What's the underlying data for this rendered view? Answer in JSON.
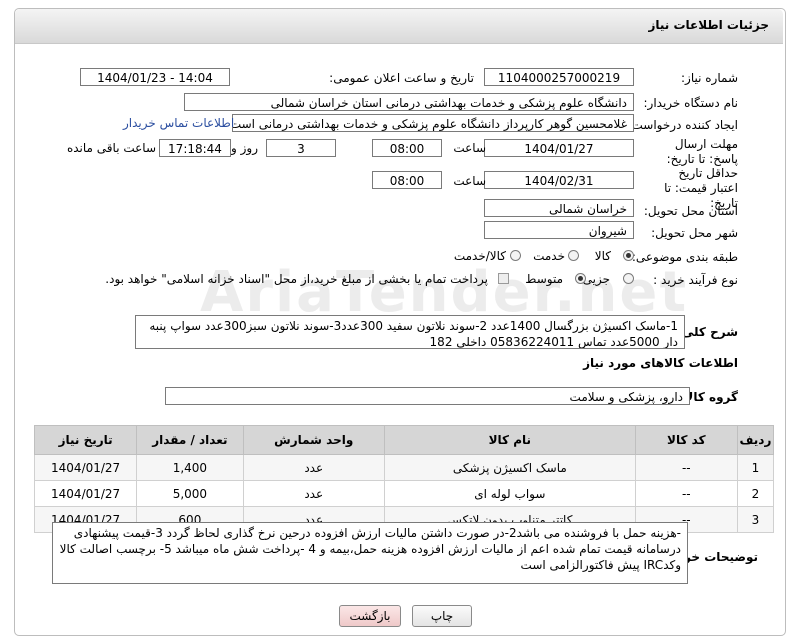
{
  "header": {
    "title": "جزئیات اطلاعات نیاز"
  },
  "fields": {
    "need_number_label": "شماره نیاز:",
    "need_number": "1104000257000219",
    "announce_label": "تاریخ و ساعت اعلان عمومی:",
    "announce_value": "1404/01/23 - 14:04",
    "buyer_org_label": "نام دستگاه خریدار:",
    "buyer_org": "دانشگاه علوم پزشکی و خدمات بهداشتی درمانی استان خراسان شمالی",
    "creator_label": "ایجاد کننده درخواست:",
    "creator": "غلامحسین گوهر کارپرداز  دانشگاه علوم پزشکی و خدمات بهداشتی درمانی است",
    "contact_link": "اطلاعات تماس خریدار",
    "reply_deadline_label": "مهلت ارسال پاسخ: تا تاریخ:",
    "reply_date": "1404/01/27",
    "time_label": "ساعت",
    "reply_time": "08:00",
    "days_count": "3",
    "days_label": "روز و",
    "remaining_time": "17:18:44",
    "remaining_label": "ساعت باقی مانده",
    "price_validity_label": "حداقل تاریخ اعتبار قیمت: تا تاریخ:",
    "price_date": "1404/02/31",
    "price_time": "08:00",
    "province_label": "استان محل تحویل:",
    "province": "خراسان شمالی",
    "city_label": "شهر محل تحویل:",
    "city": "شیروان",
    "category_label": "طبقه بندی موضوعی:",
    "category_options": [
      "کالا",
      "خدمت",
      "کالا/خدمت"
    ],
    "category_selected": "کالا",
    "process_label": "نوع فرآیند خرید :",
    "process_options": [
      "جزیی",
      "متوسط"
    ],
    "process_selected": "متوسط",
    "payment_note": "پرداخت تمام یا بخشی از مبلغ خرید،از محل \"اسناد خزانه اسلامی\" خواهد بود."
  },
  "description": {
    "label": "شرح کلی نیاز:",
    "text": "1-ماسک اکسیژن بزرگسال 1400عدد 2-سوند نلاتون سفید 300عدد3-سوند نلاتون سبز300عدد سواپ پنبه دار 5000عدد تماس 05836224011 داخلی 182"
  },
  "goods_section": {
    "title": "اطلاعات کالاهای مورد نیاز",
    "group_label": "گروه کالا:",
    "group_value": "دارو، پزشکی و سلامت"
  },
  "table": {
    "headers": [
      "ردیف",
      "کد کالا",
      "نام کالا",
      "واحد شمارش",
      "تعداد / مقدار",
      "تاریخ نیاز"
    ],
    "rows": [
      [
        "1",
        "--",
        "ماسک اکسیژن پزشکی",
        "عدد",
        "1,400",
        "1404/01/27"
      ],
      [
        "2",
        "--",
        "سواب لوله ای",
        "عدد",
        "5,000",
        "1404/01/27"
      ],
      [
        "3",
        "--",
        "کاتتر متناوب بدون لاتکس",
        "عدد",
        "600",
        "1404/01/27"
      ]
    ]
  },
  "buyer_notes": {
    "label": "توضیحات خریدار:",
    "text": "-هزینه حمل با فروشنده می باشد2-در صورت داشتن مالیات ارزش افزوده درحین نرخ گذاری لحاظ گردد 3-قیمت پیشنهادی درسامانه  قیمت تمام شده اعم از مالیات ارزش افزوده هزینه حمل،بیمه و 4 -پرداخت شش ماه میباشد 5- برچسب اصالت کالا وکدIRC پیش فاکتورالزامی است"
  },
  "buttons": {
    "print": "چاپ",
    "back": "بازگشت"
  },
  "watermark": "AriaTender.net",
  "colors": {
    "link": "#2b4ea0",
    "back_button": "#f6d9d9"
  }
}
